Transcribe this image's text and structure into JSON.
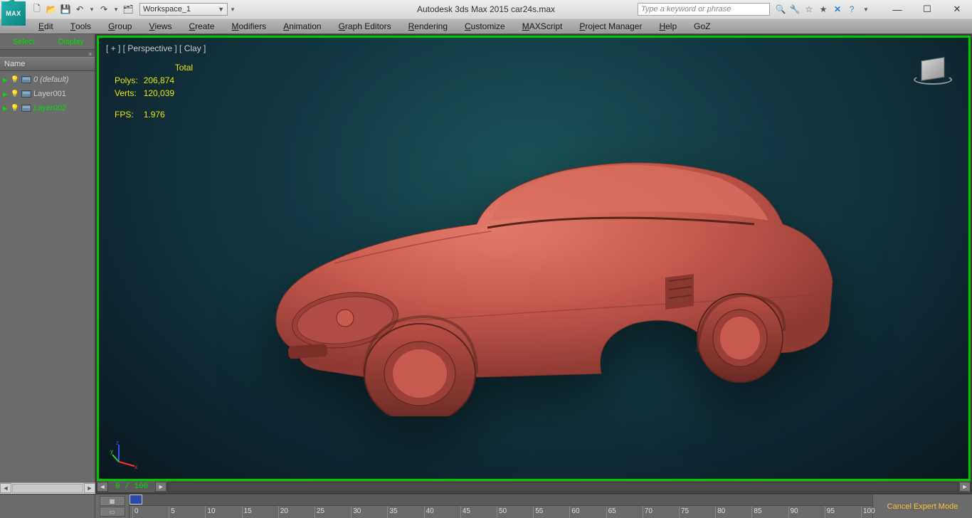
{
  "app": {
    "icon_label": "MAX",
    "title": "Autodesk 3ds Max  2015    car24s.max"
  },
  "qat": {
    "workspace": "Workspace_1"
  },
  "search": {
    "placeholder": "Type a keyword or phrase"
  },
  "menus": [
    {
      "label": "Edit",
      "u": "E"
    },
    {
      "label": "Tools",
      "u": "T"
    },
    {
      "label": "Group",
      "u": "G"
    },
    {
      "label": "Views",
      "u": "V"
    },
    {
      "label": "Create",
      "u": "C"
    },
    {
      "label": "Modifiers",
      "u": "M"
    },
    {
      "label": "Animation",
      "u": "A"
    },
    {
      "label": "Graph Editors",
      "u": "G"
    },
    {
      "label": "Rendering",
      "u": "R"
    },
    {
      "label": "Customize",
      "u": "C"
    },
    {
      "label": "MAXScript",
      "u": "M"
    },
    {
      "label": "Project Manager",
      "u": "P"
    },
    {
      "label": "Help",
      "u": "H"
    },
    {
      "label": "GoZ",
      "u": ""
    }
  ],
  "leftPanel": {
    "tabs": [
      "Select",
      "Display"
    ],
    "header": "Name",
    "layers": [
      {
        "name": "0 (default)",
        "on": false,
        "sel": false,
        "italic": true
      },
      {
        "name": "Layer001",
        "on": true,
        "sel": false,
        "italic": false
      },
      {
        "name": "Layer002",
        "on": false,
        "sel": true,
        "italic": true
      }
    ]
  },
  "viewport": {
    "label": "[ + ] [ Perspective ] [ Clay ]",
    "stats": {
      "total_hdr": "Total",
      "polys_lbl": "Polys:",
      "polys": "206,874",
      "verts_lbl": "Verts:",
      "verts": "120,039",
      "fps_lbl": "FPS:",
      "fps": "1.976"
    },
    "frame_indicator": "0 / 100"
  },
  "timeline": {
    "ticks": [
      0,
      5,
      10,
      15,
      20,
      25,
      30,
      35,
      40,
      45,
      50,
      55,
      60,
      65,
      70,
      75,
      80,
      85,
      90,
      95,
      100
    ],
    "status": "Cancel Expert Mode"
  }
}
